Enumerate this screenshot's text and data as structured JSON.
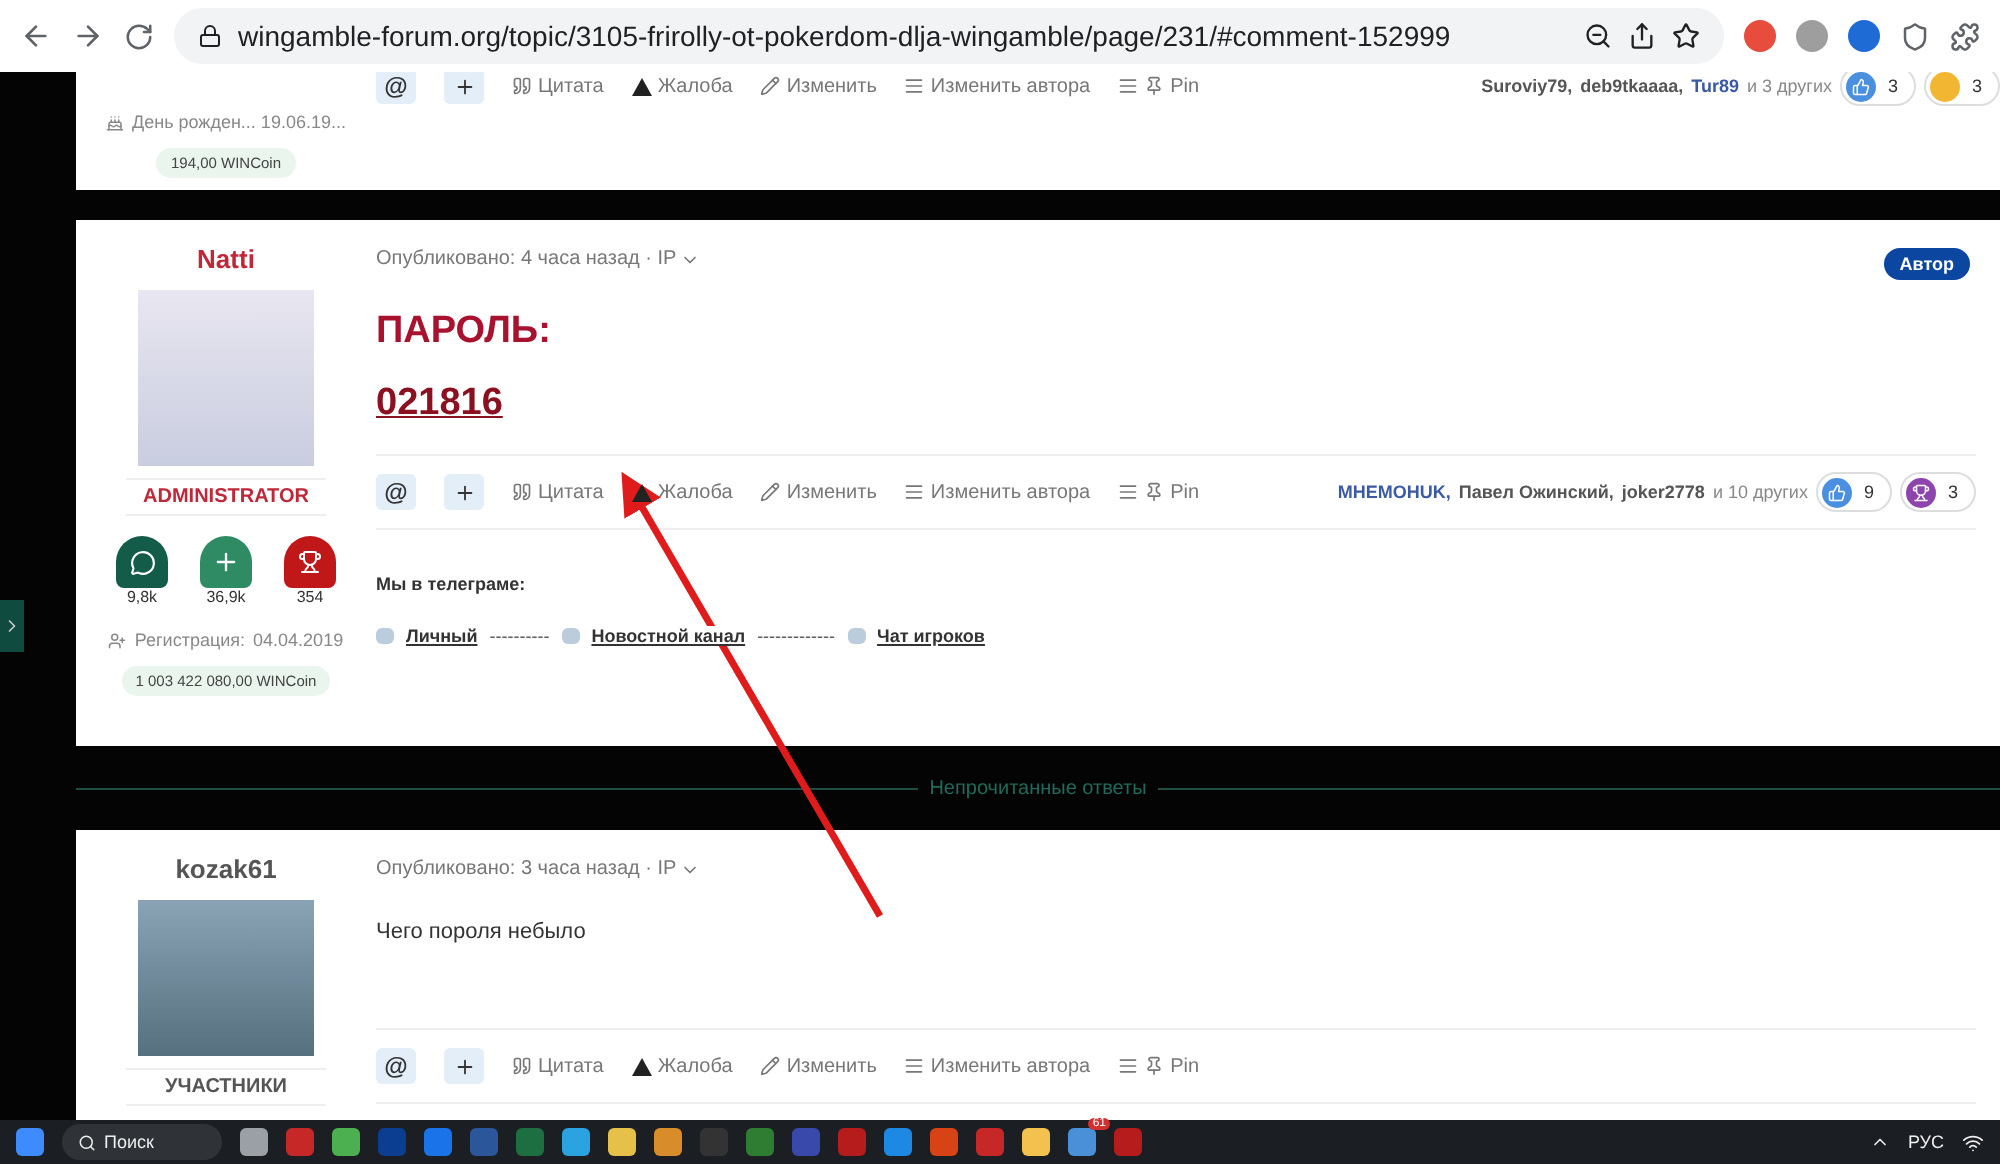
{
  "browser": {
    "url": "wingamble-forum.org/topic/3105-frirolly-ot-pokerdom-dlja-wingamble/page/231/#comment-152999"
  },
  "posts": [
    {
      "kind": "partial",
      "mention": "@",
      "birthday": "День рожден...  19.06.19...",
      "coins": "194,00 WINCoin",
      "actions": [
        "Цитата",
        "Жалоба",
        "Изменить",
        "Изменить автора",
        "Pin"
      ],
      "likers": [
        {
          "name": "Suroviy79,",
          "color": "#555555"
        },
        {
          "name": "deb9tkaaaa,",
          "color": "#555555"
        },
        {
          "name": "Tur89",
          "color": "#3b5aa6"
        }
      ],
      "likers_rest": "и 3 других",
      "reactions": [
        {
          "kind": "like",
          "count": "3"
        },
        {
          "kind": "laugh",
          "count": "3"
        }
      ]
    },
    {
      "kind": "full",
      "mention": "@",
      "author": "Natti",
      "staff": true,
      "role": "ADMINISTRATOR",
      "stats": [
        {
          "kind": "comments",
          "count": "9,8k",
          "color": "#135c4a"
        },
        {
          "kind": "plus",
          "count": "36,9k",
          "color": "#2e8b63"
        },
        {
          "kind": "trophy",
          "count": "354",
          "color": "#c01818"
        }
      ],
      "registration_label": "Регистрация:",
      "registration_date": "04.04.2019",
      "coins": "1 003 422 080,00 WINCoin",
      "meta": "Опубликовано: 4 часа назад · IP",
      "badge": "Автор",
      "heading": "ПАРОЛЬ:",
      "code": "021816",
      "actions": [
        "Цитата",
        "Жалоба",
        "Изменить",
        "Изменить автора",
        "Pin"
      ],
      "likers": [
        {
          "name": "MHEMOHUK,",
          "color": "#3b5aa6"
        },
        {
          "name": "Павел Ожинский,",
          "color": "#555555"
        },
        {
          "name": "joker2778",
          "color": "#555555"
        }
      ],
      "likers_rest": "и 10 других",
      "reactions": [
        {
          "kind": "like",
          "count": "9"
        },
        {
          "kind": "trophy",
          "count": "3"
        }
      ],
      "signature_title": "Мы в телеграме:",
      "signature_links": [
        {
          "label": "Личный",
          "separator": "----------"
        },
        {
          "label": "Новостной канал",
          "separator": "-------------"
        },
        {
          "label": "Чат игроков"
        }
      ]
    },
    {
      "kind": "unread_divider",
      "label": "Непрочитанные ответы"
    },
    {
      "kind": "full",
      "mention": "@",
      "author": "kozak61",
      "staff": false,
      "role": "УЧАСТНИКИ",
      "meta": "Опубликовано: 3 часа назад · IP",
      "text": "Чего пороля небыло",
      "actions": [
        "Цитата",
        "Жалоба",
        "Изменить",
        "Изменить автора",
        "Pin"
      ]
    }
  ],
  "taskbar": {
    "search": "Поиск",
    "apps": [
      {
        "color": "#9aa0a6"
      },
      {
        "color": "#c62828"
      },
      {
        "color": "#4caf50"
      },
      {
        "color": "#0b3d91"
      },
      {
        "color": "#1a73e8"
      },
      {
        "color": "#2b579a"
      },
      {
        "color": "#1d6f42"
      },
      {
        "color": "#2aa3e0"
      },
      {
        "color": "#e6c14a"
      },
      {
        "color": "#d98c2a"
      },
      {
        "color": "#333333"
      },
      {
        "color": "#2e7d32"
      },
      {
        "color": "#3949ab"
      },
      {
        "color": "#b71c1c"
      },
      {
        "color": "#1e88e5"
      },
      {
        "color": "#d84315"
      },
      {
        "color": "#c62828"
      },
      {
        "color": "#f2c14e"
      },
      {
        "color": "#4a90d9",
        "badge": "61"
      },
      {
        "color": "#b71c1c"
      }
    ],
    "language": "РУС"
  }
}
